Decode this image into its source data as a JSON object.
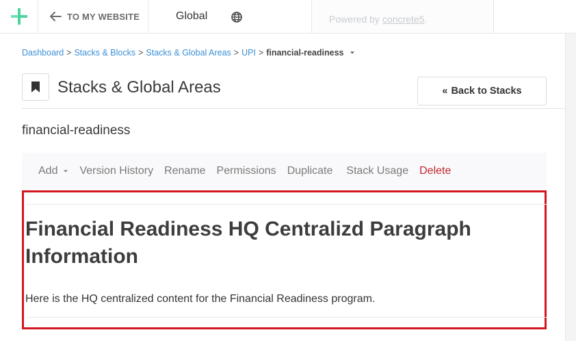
{
  "toolbar": {
    "back_label": "TO MY WEBSITE",
    "global_label": "Global",
    "powered_prefix": "Powered by",
    "powered_link": "concrete5",
    "powered_suffix": ".",
    "accent_color": "#4cd4a0"
  },
  "breadcrumb": {
    "items": [
      "Dashboard",
      "Stacks & Blocks",
      "Stacks & Global Areas",
      "UPI"
    ],
    "separator": ">",
    "current": "financial-readiness"
  },
  "header": {
    "title": "Stacks & Global Areas",
    "back_button_label": "Back to Stacks",
    "back_button_glyph": "«"
  },
  "stack": {
    "name": "financial-readiness"
  },
  "menu": {
    "add": "Add",
    "version_history": "Version History",
    "rename": "Rename",
    "permissions": "Permissions",
    "duplicate": "Duplicate",
    "stack_usage": "Stack Usage",
    "delete": "Delete"
  },
  "content": {
    "heading": "Financial Readiness HQ Centralizd Paragraph Information",
    "paragraph": "Here is the HQ centralized content for the Financial Readiness program.",
    "highlight_color": "#d2151e"
  },
  "icons": {
    "logo": "plus-logo-icon",
    "back": "arrow-left-icon",
    "globe": "globe-icon",
    "page": "bookmark-icon",
    "caret": "caret-down-icon"
  }
}
